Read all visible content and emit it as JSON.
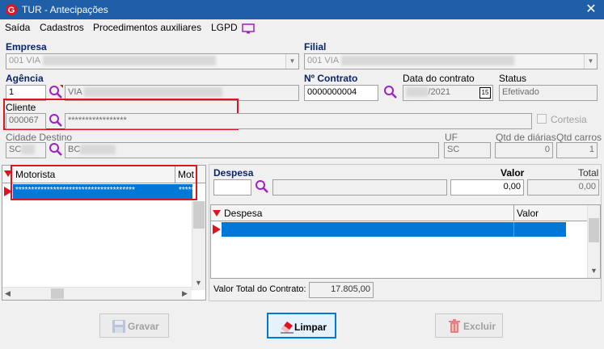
{
  "window": {
    "title": "TUR - Antecipações",
    "close_glyph": "✕"
  },
  "menu": {
    "items": [
      "Saída",
      "Cadastros",
      "Procedimentos auxiliares",
      "LGPD"
    ]
  },
  "empresa": {
    "label": "Empresa",
    "value": "001 VIA"
  },
  "filial": {
    "label": "Filial",
    "value": "001 VIA"
  },
  "agencia": {
    "label": "Agência",
    "code": "1",
    "name": "VIA"
  },
  "contrato": {
    "label": "Nº Contrato",
    "value": "0000000004",
    "data_label": "Data do contrato",
    "data_value": "/2021",
    "calendar": "15",
    "status_label": "Status",
    "status_value": "Efetivado"
  },
  "cliente": {
    "label": "Cliente",
    "code": "000067",
    "name": "*****************",
    "cortesia_label": "Cortesia"
  },
  "destino": {
    "label": "Cidade Destino",
    "code": "SC",
    "name": "BC",
    "uf_label": "UF",
    "uf_value": "SC",
    "diarias_label": "Qtd de diárias",
    "diarias_value": "0",
    "carros_label": "Qtd carros",
    "carros_value": "1"
  },
  "motorista_grid": {
    "columns": [
      "Motorista",
      "Mot"
    ],
    "row": [
      "**************************************",
      "*****"
    ]
  },
  "despesa": {
    "label": "Despesa",
    "valor_label": "Valor",
    "total_label": "Total",
    "valor_value": "0,00",
    "total_value": "0,00"
  },
  "despesa_grid": {
    "columns": [
      "Despesa",
      "Valor"
    ]
  },
  "valor_total": {
    "label": "Valor Total do Contrato:",
    "value": "17.805,00"
  },
  "buttons": {
    "gravar": "Gravar",
    "limpar": "Limpar",
    "excluir": "Excluir"
  },
  "colors": {
    "titlebar": "#1f5fa8",
    "highlight": "#e0141e",
    "selection": "#0078d7",
    "label_blue": "#0a246a"
  }
}
